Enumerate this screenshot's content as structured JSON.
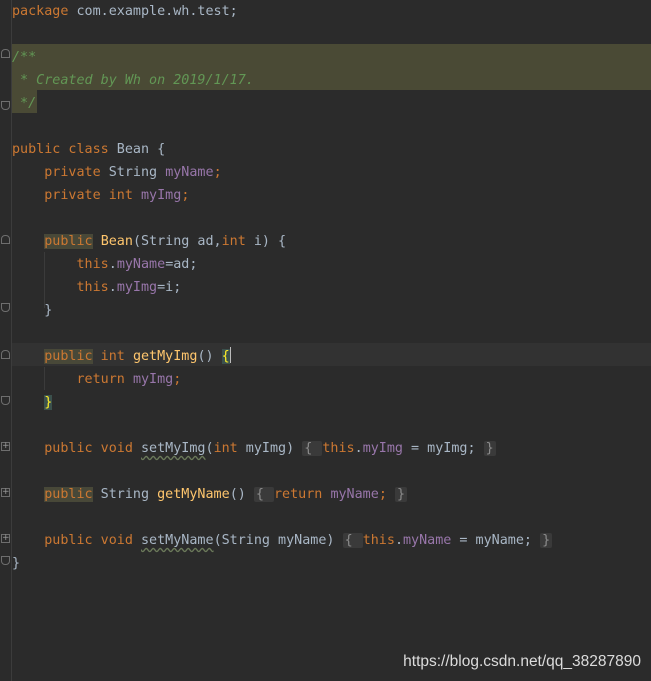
{
  "editor": {
    "colors": {
      "background": "#2b2b2b",
      "keyword": "#cc7832",
      "comment": "#629755",
      "field": "#9876aa",
      "method": "#ffc66d"
    },
    "lines": {
      "l0": {
        "kw": "package",
        "rest": " com.example.wh.test;"
      },
      "l2": {
        "text": "/**"
      },
      "l3": {
        "text": " * Created by Wh on 2019/1/17."
      },
      "l4": {
        "text": " */"
      },
      "l6": {
        "kw1": "public",
        "kw2": " class",
        "rest": " Bean {"
      },
      "l7": {
        "indent": "    ",
        "kw": "private",
        "type": " String ",
        "fld": "myName",
        "end": ";"
      },
      "l8": {
        "indent": "    ",
        "kw": "private",
        "type": " int ",
        "fld": "myImg",
        "end": ";"
      },
      "l10": {
        "indent": "    ",
        "kw": "public",
        "sp": " ",
        "fn": "Bean",
        "p1": "(String ad,",
        "kw2": "int",
        "p2": " i) {"
      },
      "l11": {
        "indent": "        ",
        "kw": "this",
        "dot": ".",
        "fld": "myName",
        "rest": "=ad;"
      },
      "l12": {
        "indent": "        ",
        "kw": "this",
        "dot": ".",
        "fld": "myImg",
        "rest": "=i;"
      },
      "l13": {
        "text": "    }"
      },
      "l15": {
        "indent": "    ",
        "kw1": "public",
        "kw2": " int",
        "sp": " ",
        "fn": "getMyImg",
        "rest": "() ",
        "brace": "{"
      },
      "l16": {
        "indent": "        ",
        "kw": "return",
        "sp": " ",
        "fld": "myImg",
        "end": ";"
      },
      "l17": {
        "indent": "    ",
        "brace": "}"
      },
      "l19": {
        "indent": "    ",
        "kw1": "public",
        "kw2": " void",
        "sp": " ",
        "fn": "setMyImg",
        "p1": "(",
        "kw3": "int",
        "p2": " myImg) ",
        "f1": "{ ",
        "kw4": "this",
        "dot": ".",
        "fld": "myImg",
        "mid": " = myImg; ",
        "f2": "}"
      },
      "l21": {
        "indent": "    ",
        "kw1": "public",
        "p1": " String ",
        "fn": "getMyName",
        "p2": "() ",
        "f1": "{ ",
        "kw2": "return",
        "sp": " ",
        "fld": "myName",
        "mid": "; ",
        "f2": "}"
      },
      "l23": {
        "indent": "    ",
        "kw1": "public",
        "kw2": " void",
        "sp": " ",
        "fn": "setMyName",
        "p1": "(String myName) ",
        "f1": "{ ",
        "kw3": "this",
        "dot": ".",
        "fld": "myName",
        "mid": " = myName; ",
        "f2": "}"
      },
      "l24": {
        "text": "}"
      }
    },
    "fold_markers": {
      "collapsed": "+",
      "expanded": "−"
    }
  },
  "watermark": "https://blog.csdn.net/qq_38287890"
}
